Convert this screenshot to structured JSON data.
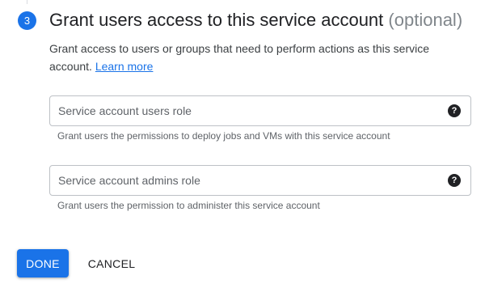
{
  "step": {
    "number": "3",
    "title": "Grant users access to this service account",
    "optional": "(optional)",
    "description": "Grant access to users or groups that need to perform actions as this service account.",
    "learn_more": "Learn more"
  },
  "fields": [
    {
      "placeholder": "Service account users role",
      "value": "",
      "help_icon": "help-circle-icon",
      "hint": "Grant users the permissions to deploy jobs and VMs with this service account"
    },
    {
      "placeholder": "Service account admins role",
      "value": "",
      "help_icon": "help-circle-icon",
      "hint": "Grant users the permission to administer this service account"
    }
  ],
  "actions": {
    "done_label": "DONE",
    "cancel_label": "CANCEL"
  },
  "colors": {
    "accent": "#1a73e8",
    "text": "#202124",
    "muted": "#5f6368"
  }
}
